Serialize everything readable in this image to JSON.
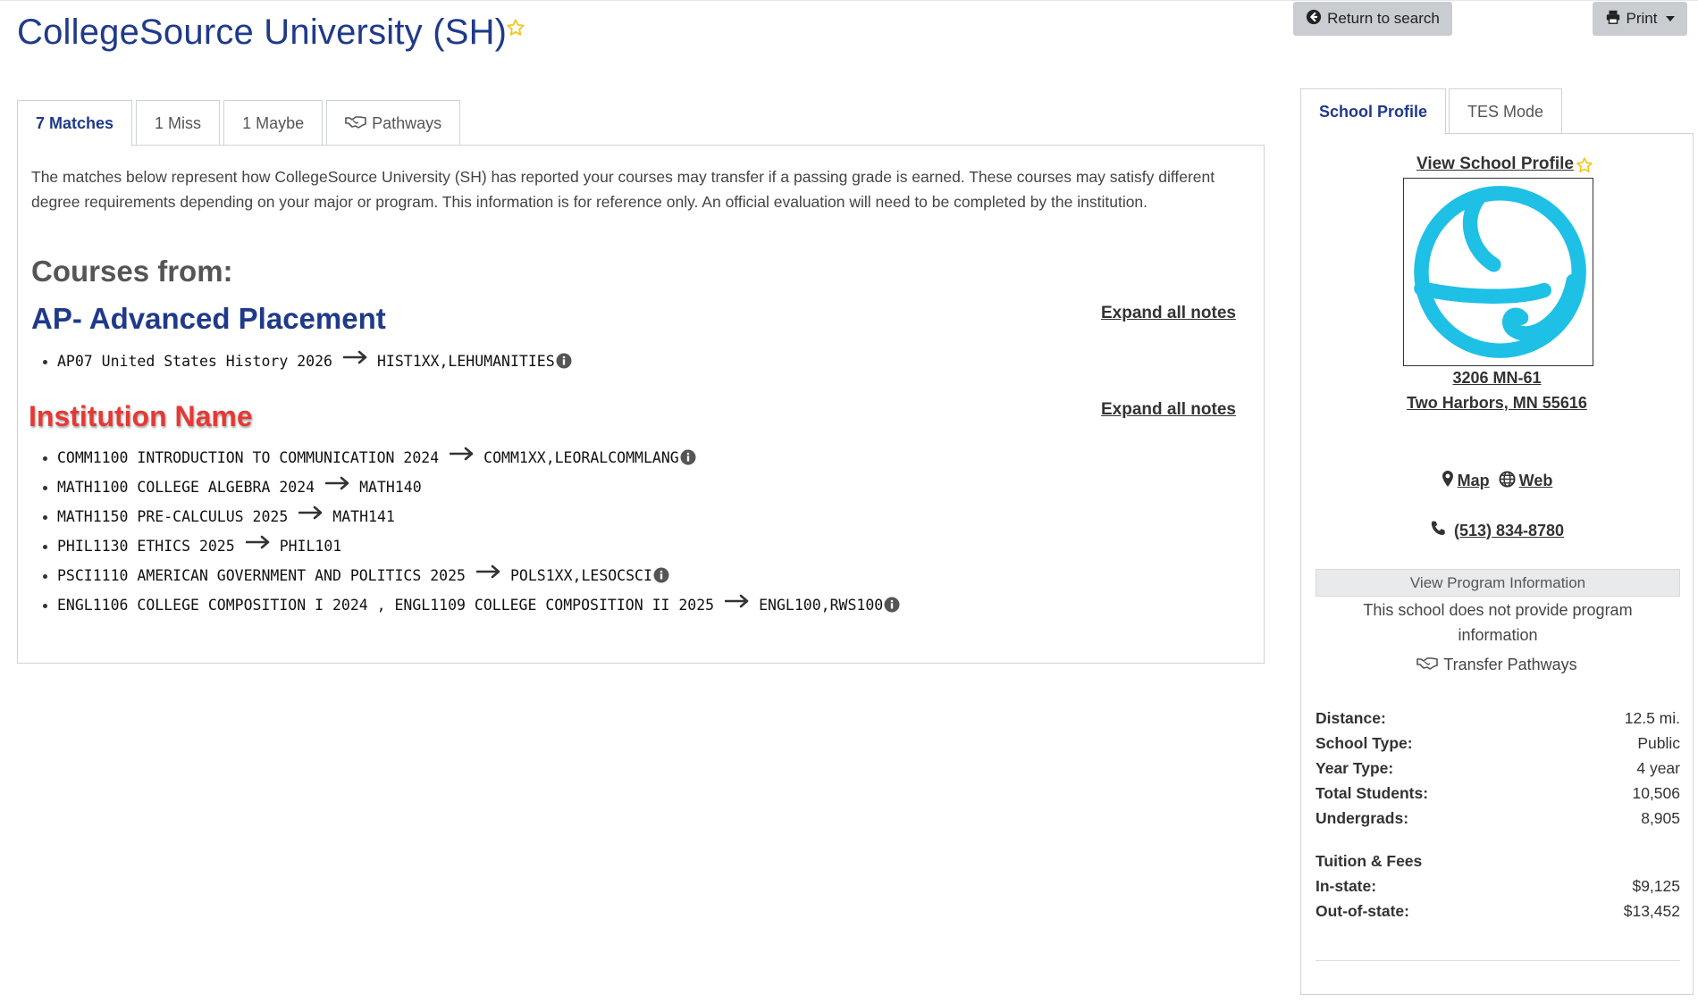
{
  "header": {
    "title": "CollegeSource University (SH)",
    "return_label": "Return to search",
    "print_label": "Print"
  },
  "tabs": [
    {
      "label": "7 Matches"
    },
    {
      "label": "1 Miss"
    },
    {
      "label": "1 Maybe"
    },
    {
      "label": "Pathways"
    }
  ],
  "intro": "The matches below represent how CollegeSource University (SH) has reported your courses may transfer if a passing grade is earned. These courses may satisfy different degree requirements depending on your major or program. This information is for reference only. An official evaluation will need to be completed by the institution.",
  "courses_from": "Courses from:",
  "expand_label": "Expand all notes",
  "groups": [
    {
      "title": "AP- Advanced Placement",
      "courses": [
        {
          "from": "AP07 United States History 2026",
          "to": "HIST1XX,LEHUMANITIES",
          "info": true
        }
      ]
    },
    {
      "title": "Institution Name",
      "courses": [
        {
          "from": "COMM1100 INTRODUCTION TO COMMUNICATION 2024",
          "to": "COMM1XX,LEORALCOMMLANG",
          "info": true
        },
        {
          "from": "MATH1100 COLLEGE ALGEBRA 2024",
          "to": "MATH140",
          "info": false
        },
        {
          "from": "MATH1150 PRE-CALCULUS 2025",
          "to": "MATH141",
          "info": false
        },
        {
          "from": "PHIL1130 ETHICS 2025",
          "to": "PHIL101",
          "info": false
        },
        {
          "from": "PSCI1110 AMERICAN GOVERNMENT AND POLITICS 2025",
          "to": "POLS1XX,LESOCSCI",
          "info": true
        },
        {
          "from": "ENGL1106 COLLEGE COMPOSITION I 2024 , ENGL1109 COLLEGE COMPOSITION II 2025",
          "to": "ENGL100,RWS100",
          "info": true
        }
      ]
    }
  ],
  "sidebar": {
    "tabs": [
      {
        "label": "School Profile"
      },
      {
        "label": "TES Mode"
      }
    ],
    "view_profile": "View School Profile",
    "address_line1": "3206 MN-61",
    "address_line2": "Two Harbors, MN 55616",
    "map_label": "Map",
    "web_label": "Web",
    "phone": "(513) 834-8780",
    "program_button": "View Program Information",
    "no_program": "This school does not provide program information",
    "pathways": "Transfer Pathways",
    "stats": [
      {
        "label": "Distance:",
        "value": "12.5 mi."
      },
      {
        "label": "School Type:",
        "value": "Public"
      },
      {
        "label": "Year Type:",
        "value": "4 year"
      },
      {
        "label": "Total Students:",
        "value": "10,506"
      },
      {
        "label": "Undergrads:",
        "value": "8,905"
      }
    ],
    "tuition_heading": "Tuition & Fees",
    "tuition": [
      {
        "label": "In-state:",
        "value": "$9,125"
      },
      {
        "label": "Out-of-state:",
        "value": "$13,452"
      }
    ]
  },
  "colors": {
    "brand_blue": "#1f3a8a",
    "logo_cyan": "#1ec0e6",
    "annotation_red": "#e53935",
    "star_yellow": "#f5c518"
  }
}
